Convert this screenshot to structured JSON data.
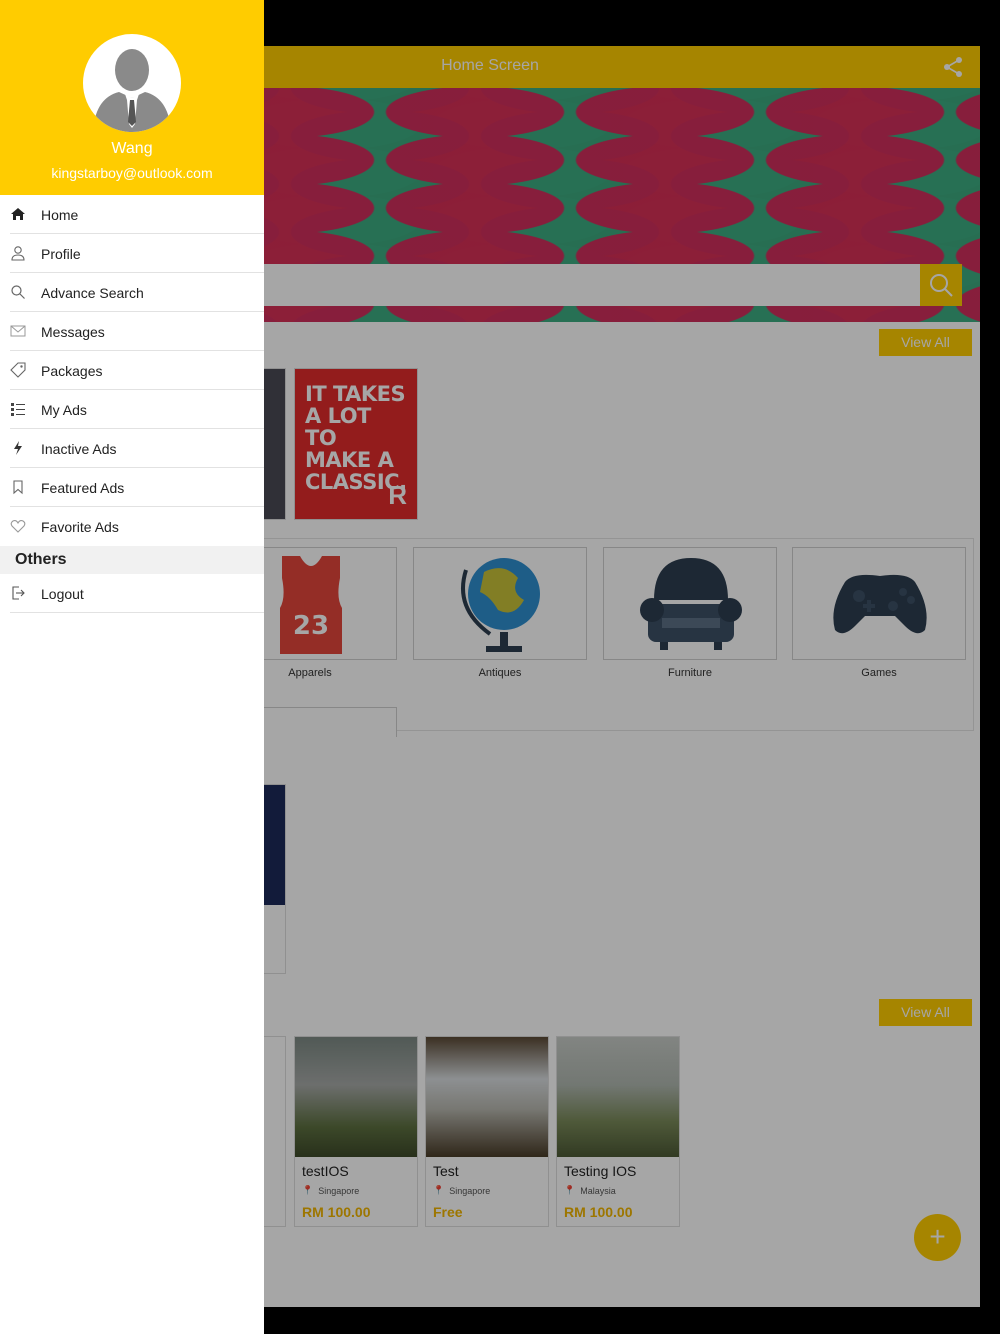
{
  "app": {
    "title": "Home Screen",
    "view_all_label": "View All",
    "promo_text": "IT TAKES A LOT TO MAKE A CLASSIC.",
    "categories": [
      {
        "label": "Apparels",
        "number": "23"
      },
      {
        "label": "Antiques"
      },
      {
        "label": "Furniture"
      },
      {
        "label": "Games"
      }
    ],
    "ads": [
      {
        "title": "testIOS",
        "location": "Singapore",
        "price": "RM 100.00"
      },
      {
        "title": "Test",
        "location": "Singapore",
        "price": "Free"
      },
      {
        "title": "Testing IOS",
        "location": "Malaysia",
        "price": "RM 100.00"
      }
    ],
    "fab_label": "+",
    "colors": {
      "accent": "#ffcc00",
      "price": "#f2b600"
    }
  },
  "drawer": {
    "user_name": "Wang",
    "user_email": "kingstarboy@outlook.com",
    "items": [
      {
        "label": "Home",
        "icon": "home-icon"
      },
      {
        "label": "Profile",
        "icon": "user-icon"
      },
      {
        "label": "Advance Search",
        "icon": "search-icon"
      },
      {
        "label": "Messages",
        "icon": "envelope-icon"
      },
      {
        "label": "Packages",
        "icon": "tag-icon"
      },
      {
        "label": "My Ads",
        "icon": "list-icon"
      },
      {
        "label": "Inactive Ads",
        "icon": "bolt-icon"
      },
      {
        "label": "Featured Ads",
        "icon": "bookmark-icon"
      },
      {
        "label": "Favorite Ads",
        "icon": "heart-icon"
      }
    ],
    "section_title": "Others",
    "logout_label": "Logout"
  }
}
